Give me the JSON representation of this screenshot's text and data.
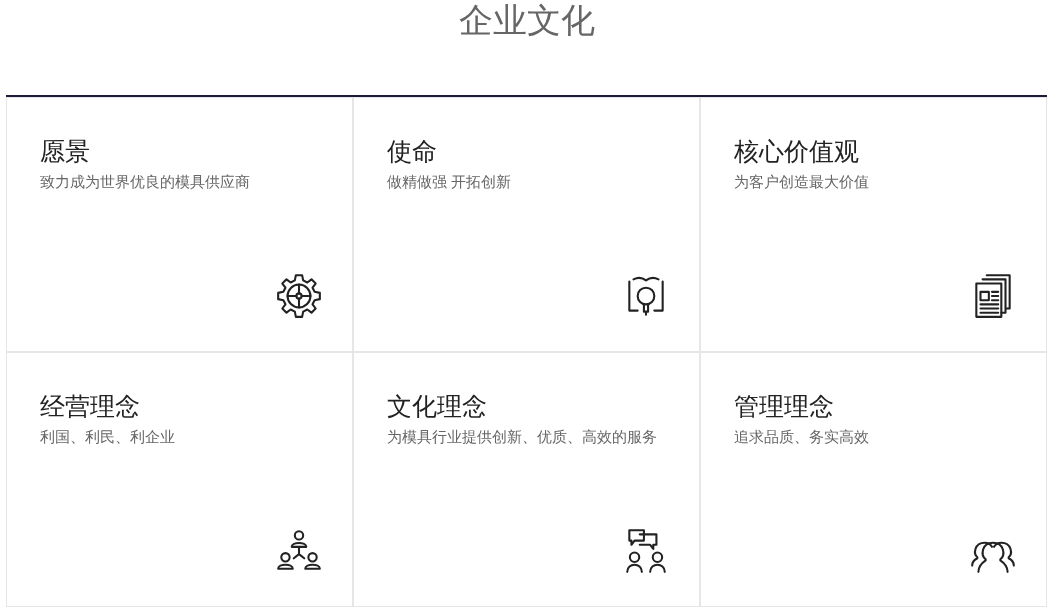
{
  "title": "企业文化",
  "cards": [
    {
      "kind": "gear",
      "heading": "愿景",
      "text": "致力成为世界优良的模具供应商"
    },
    {
      "kind": "book",
      "heading": "使命",
      "text": "做精做强 开拓创新"
    },
    {
      "kind": "documents",
      "heading": "核心价值观",
      "text": "为客户创造最大价值"
    },
    {
      "kind": "network",
      "heading": "经营理念",
      "text": "利国、利民、利企业"
    },
    {
      "kind": "chat",
      "heading": "文化理念",
      "text": "为模具行业提供创新、优质、高效的服务"
    },
    {
      "kind": "people",
      "heading": "管理理念",
      "text": "追求品质、务实高效"
    }
  ]
}
